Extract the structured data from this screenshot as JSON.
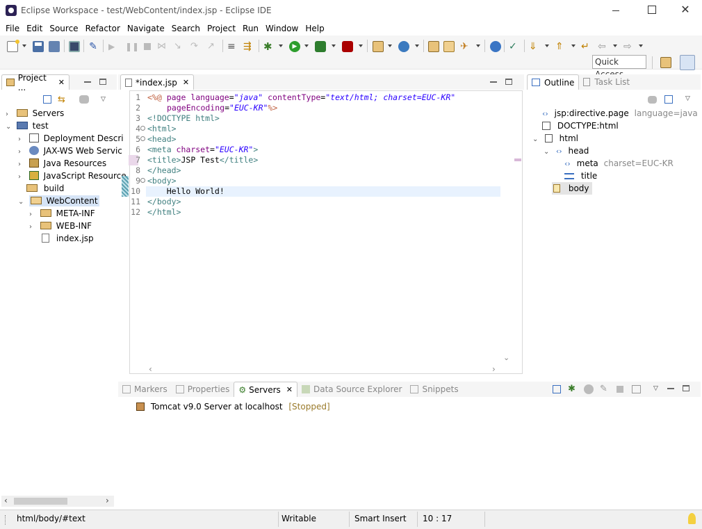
{
  "window": {
    "title": "Eclipse Workspace - test/WebContent/index.jsp - Eclipse IDE"
  },
  "menu": [
    "File",
    "Edit",
    "Source",
    "Refactor",
    "Navigate",
    "Search",
    "Project",
    "Run",
    "Window",
    "Help"
  ],
  "toolbar": {
    "quick_access": "Quick Access"
  },
  "project_explorer": {
    "tab_label": "Project ...",
    "items": [
      {
        "label": "Servers",
        "icon": "folder-server-icon"
      },
      {
        "label": "test",
        "icon": "web-project-icon"
      },
      {
        "label": "Deployment Descri",
        "icon": "deployment-icon"
      },
      {
        "label": "JAX-WS Web Servic",
        "icon": "jaxws-icon"
      },
      {
        "label": "Java Resources",
        "icon": "java-resources-icon"
      },
      {
        "label": "JavaScript Resource",
        "icon": "js-resources-icon"
      },
      {
        "label": "build",
        "icon": "folder-icon"
      },
      {
        "label": "WebContent",
        "icon": "folder-open-icon"
      },
      {
        "label": "META-INF",
        "icon": "folder-icon"
      },
      {
        "label": "WEB-INF",
        "icon": "folder-icon"
      },
      {
        "label": "index.jsp",
        "icon": "jsp-file-icon"
      }
    ]
  },
  "editor": {
    "tab_label": "*index.jsp",
    "line_numbers": [
      "1",
      "2",
      "3",
      "4",
      "5",
      "6",
      "7",
      "8",
      "9",
      "10",
      "11",
      "12"
    ],
    "current_line": 10,
    "code": {
      "l1": {
        "open": "<%@",
        "kw": " page ",
        "a1": "language",
        "eq1": "=",
        "v1": "\"java\"",
        "a2": " contentType",
        "eq2": "=",
        "v2": "\"text/html; charset=EUC-KR\""
      },
      "l2": {
        "a1": "pageEncoding",
        "eq1": "=",
        "v1": "\"EUC-KR\"",
        "close": "%>"
      },
      "l3": "<!DOCTYPE html>",
      "l4": "<html>",
      "l5": "<head>",
      "l6": {
        "open": "<meta",
        "a1": " charset",
        "eq1": "=",
        "v1": "\"EUC-KR\"",
        "close": ">"
      },
      "l7": {
        "open": "<title>",
        "text": "JSP Test",
        "close": "</title>"
      },
      "l8": "</head>",
      "l9": "<body>",
      "l10": "    Hello World!",
      "l11": "</body>",
      "l12": "</html>"
    }
  },
  "outline": {
    "tab_label": "Outline",
    "other_tab": "Task List",
    "items": [
      {
        "label": "jsp:directive.page",
        "detail": "language=java",
        "icon": "directive-icon"
      },
      {
        "label": "DOCTYPE:html",
        "detail": "",
        "icon": "doctype-icon"
      },
      {
        "label": "html",
        "detail": "",
        "icon": "element-icon"
      },
      {
        "label": "head",
        "detail": "",
        "icon": "element-icon"
      },
      {
        "label": "meta",
        "detail": "charset=EUC-KR",
        "icon": "element-icon"
      },
      {
        "label": "title",
        "detail": "",
        "icon": "title-icon"
      },
      {
        "label": "body",
        "detail": "",
        "icon": "body-icon"
      }
    ]
  },
  "bottom": {
    "tabs": [
      "Markers",
      "Properties",
      "Servers",
      "Data Source Explorer",
      "Snippets"
    ],
    "active_tab": "Servers",
    "servers": [
      {
        "name": "Tomcat v9.0 Server at localhost",
        "state": "[Stopped]"
      }
    ]
  },
  "status": {
    "path": "html/body/#text",
    "mode": "Writable",
    "insert": "Smart Insert",
    "position": "10 : 17"
  }
}
